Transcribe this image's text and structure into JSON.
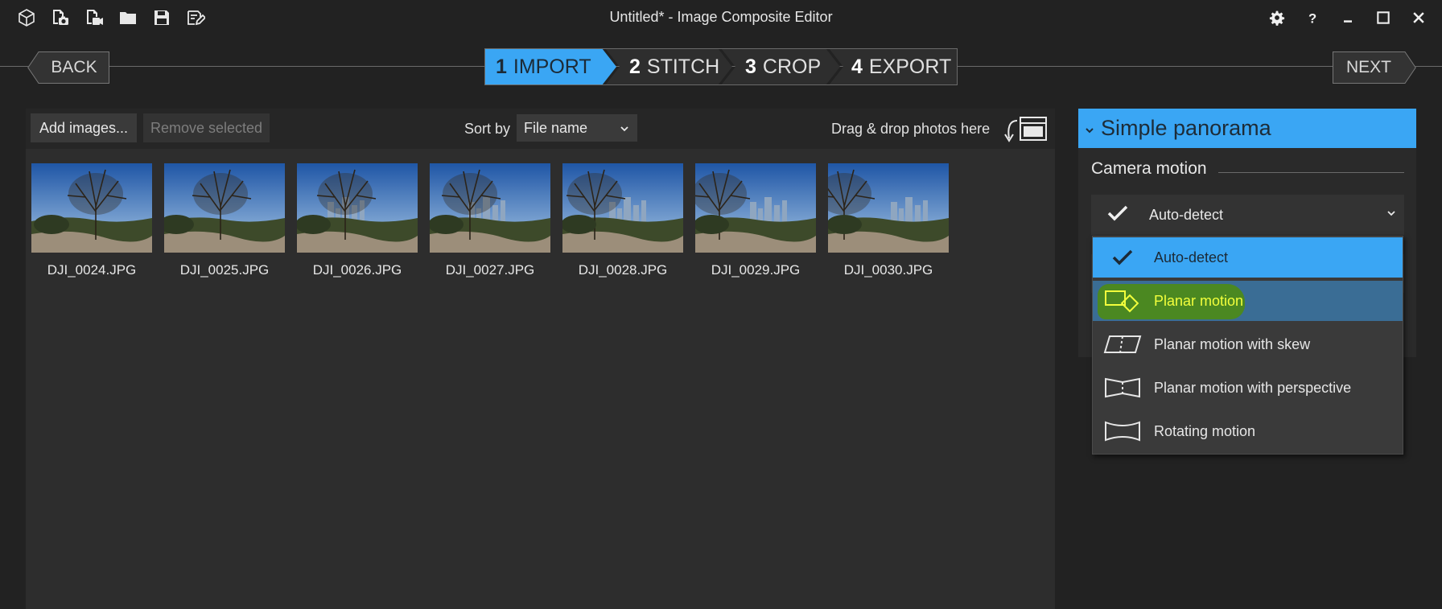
{
  "window": {
    "title": "Untitled* - Image Composite Editor",
    "toolbar_icons": [
      "new-project-icon",
      "new-panorama-icon",
      "new-video-panorama-icon",
      "open-folder-icon",
      "save-icon",
      "save-as-icon"
    ],
    "controls": [
      "settings-icon",
      "help-icon",
      "minimize-icon",
      "maximize-icon",
      "close-icon"
    ]
  },
  "wizard": {
    "back_label": "BACK",
    "next_label": "NEXT",
    "steps": [
      {
        "num": "1",
        "label": "IMPORT",
        "active": true
      },
      {
        "num": "2",
        "label": "STITCH",
        "active": false
      },
      {
        "num": "3",
        "label": "CROP",
        "active": false
      },
      {
        "num": "4",
        "label": "EXPORT",
        "active": false
      }
    ]
  },
  "import_toolbar": {
    "add_label": "Add images...",
    "remove_label": "Remove selected",
    "sort_label": "Sort by",
    "sort_value": "File name",
    "drop_label": "Drag & drop photos here"
  },
  "images": [
    {
      "name": "DJI_0024.JPG"
    },
    {
      "name": "DJI_0025.JPG"
    },
    {
      "name": "DJI_0026.JPG"
    },
    {
      "name": "DJI_0027.JPG"
    },
    {
      "name": "DJI_0028.JPG"
    },
    {
      "name": "DJI_0029.JPG"
    },
    {
      "name": "DJI_0030.JPG"
    }
  ],
  "panel": {
    "header": "Simple panorama",
    "camera_motion_label": "Camera motion",
    "camera_motion_value": "Auto-detect",
    "options": [
      {
        "label": "Auto-detect",
        "icon": "checkmark-icon",
        "state": "selected"
      },
      {
        "label": "Planar motion",
        "icon": "planar-motion-icon",
        "state": "highlighted"
      },
      {
        "label": "Planar motion with skew",
        "icon": "planar-skew-icon",
        "state": "normal"
      },
      {
        "label": "Planar motion with perspective",
        "icon": "planar-perspective-icon",
        "state": "normal"
      },
      {
        "label": "Rotating motion",
        "icon": "rotating-motion-icon",
        "state": "normal"
      }
    ]
  },
  "colors": {
    "accent": "#3aa6f4",
    "background": "#222222",
    "panel": "#2d2d2d",
    "highlight_marker": "#4c8a1a",
    "highlight_text": "#f2ff3c"
  }
}
